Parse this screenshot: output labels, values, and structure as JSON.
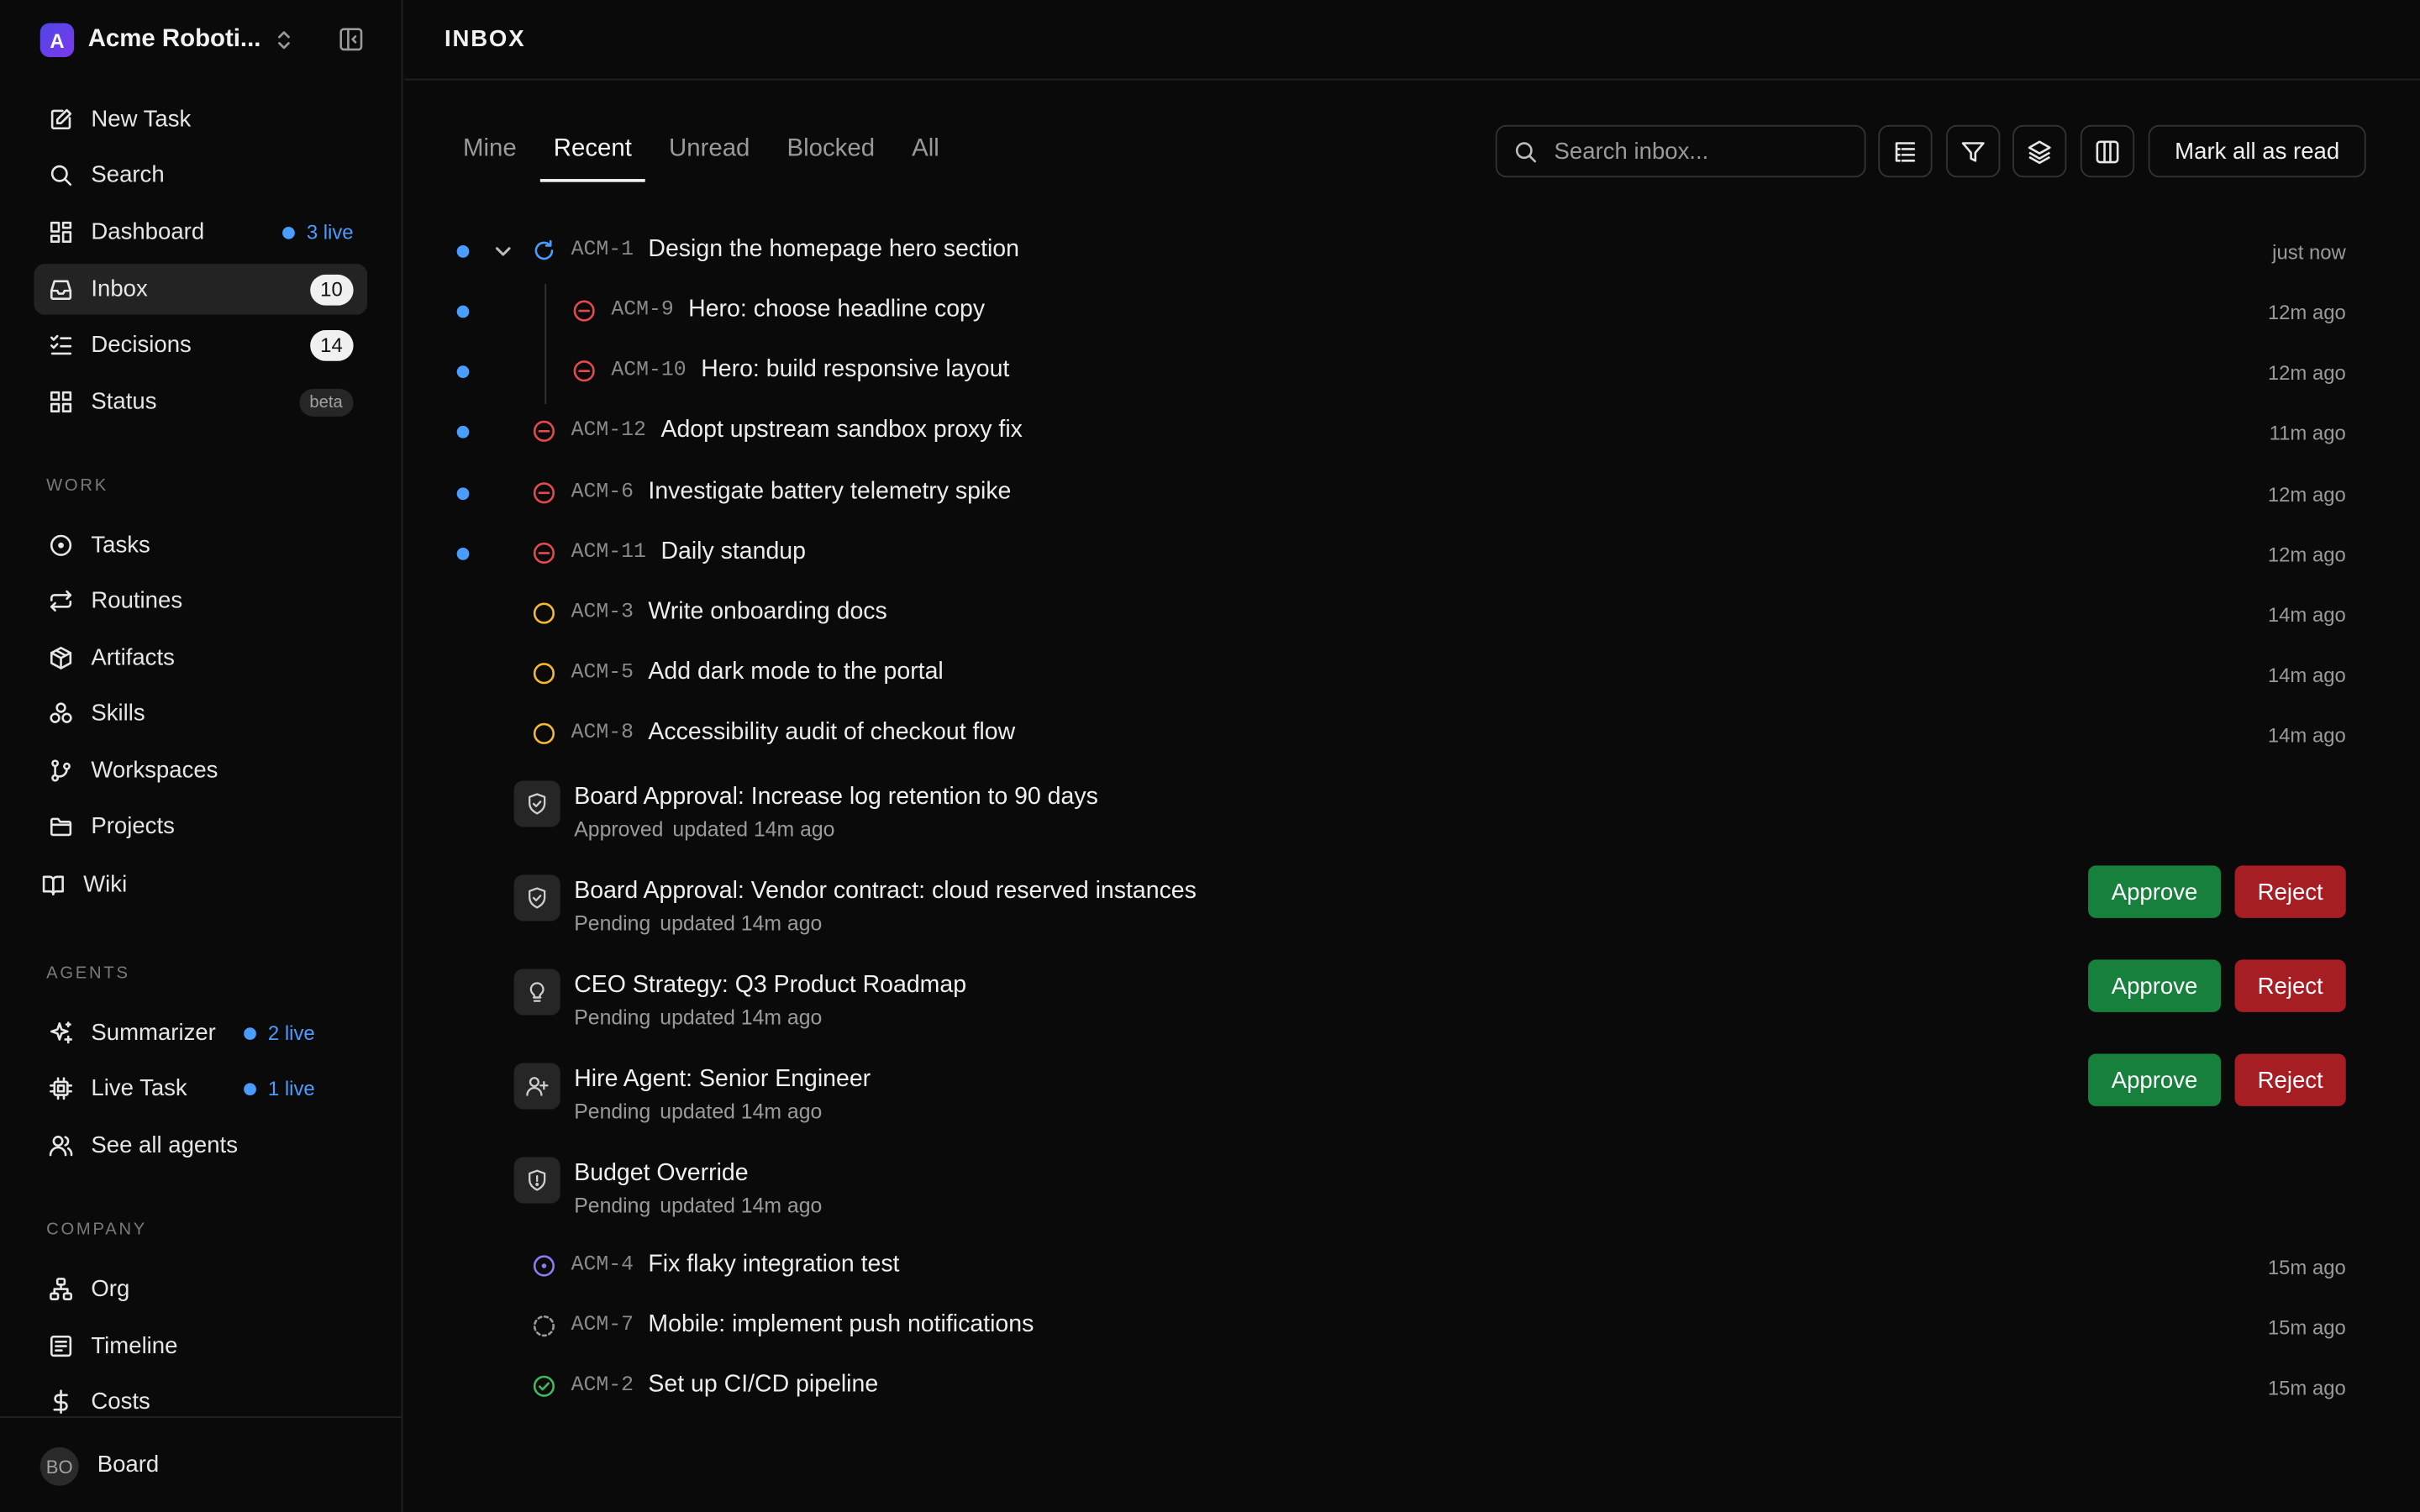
{
  "workspace": {
    "name": "Acme Roboti...",
    "logo_letter": "A"
  },
  "nav": [
    {
      "id": "new-task",
      "label": "New Task",
      "icon": "edit-icon"
    },
    {
      "id": "search",
      "label": "Search",
      "icon": "search-icon"
    },
    {
      "id": "dashboard",
      "label": "Dashboard",
      "icon": "dashboard-icon",
      "live": "3 live"
    },
    {
      "id": "inbox",
      "label": "Inbox",
      "icon": "inbox-icon",
      "count": "10",
      "active": true
    },
    {
      "id": "decisions",
      "label": "Decisions",
      "icon": "checklist-icon",
      "count": "14"
    },
    {
      "id": "status",
      "label": "Status",
      "icon": "grid-icon",
      "badge": "beta"
    }
  ],
  "sections": {
    "work": {
      "label": "WORK",
      "items": [
        {
          "label": "Tasks",
          "icon": "circle-dot-icon"
        },
        {
          "label": "Routines",
          "icon": "repeat-icon"
        },
        {
          "label": "Artifacts",
          "icon": "package-icon"
        },
        {
          "label": "Skills",
          "icon": "boxes-icon"
        },
        {
          "label": "Workspaces",
          "icon": "git-branch-icon"
        },
        {
          "label": "Projects",
          "icon": "folder-icon"
        },
        {
          "label": "Wiki",
          "icon": "book-icon"
        }
      ]
    },
    "agents": {
      "label": "AGENTS",
      "items": [
        {
          "label": "Summarizer",
          "icon": "sparkles-icon",
          "live": "2 live"
        },
        {
          "label": "Live Task",
          "icon": "cpu-icon",
          "live": "1 live"
        },
        {
          "label": "See all agents",
          "icon": "users-icon"
        }
      ]
    },
    "company": {
      "label": "COMPANY",
      "items": [
        {
          "label": "Org",
          "icon": "org-icon"
        },
        {
          "label": "Timeline",
          "icon": "timeline-icon"
        },
        {
          "label": "Costs",
          "icon": "dollar-icon"
        }
      ]
    }
  },
  "user": {
    "initials": "BO",
    "name": "Board"
  },
  "page": {
    "title": "INBOX"
  },
  "tabs": [
    "Mine",
    "Recent",
    "Unread",
    "Blocked",
    "All"
  ],
  "active_tab": "Recent",
  "search": {
    "placeholder": "Search inbox..."
  },
  "mark_all_label": "Mark all as read",
  "tasks_top": [
    {
      "key": "ACM-1",
      "title": "Design the homepage hero section",
      "time": "just now",
      "status": "in-progress",
      "unread": true
    },
    {
      "key": "ACM-9",
      "title": "Hero: choose headline copy",
      "time": "12m ago",
      "status": "blocked",
      "unread": true
    },
    {
      "key": "ACM-10",
      "title": "Hero: build responsive layout",
      "time": "12m ago",
      "status": "blocked",
      "unread": true
    },
    {
      "key": "ACM-12",
      "title": "Adopt upstream sandbox proxy fix",
      "time": "11m ago",
      "status": "blocked",
      "unread": true
    },
    {
      "key": "ACM-6",
      "title": "Investigate battery telemetry spike",
      "time": "12m ago",
      "status": "blocked",
      "unread": true
    },
    {
      "key": "ACM-11",
      "title": "Daily standup",
      "time": "12m ago",
      "status": "blocked",
      "unread": true
    },
    {
      "key": "ACM-3",
      "title": "Write onboarding docs",
      "time": "14m ago",
      "status": "todo",
      "unread": false
    },
    {
      "key": "ACM-5",
      "title": "Add dark mode to the portal",
      "time": "14m ago",
      "status": "todo",
      "unread": false
    },
    {
      "key": "ACM-8",
      "title": "Accessibility audit of checkout flow",
      "time": "14m ago",
      "status": "todo",
      "unread": false
    }
  ],
  "approvals": [
    {
      "title": "Board Approval: Increase log retention to 90 days",
      "state": "Approved",
      "updated": "updated 14m ago",
      "icon": "shield-check-icon",
      "actions": false
    },
    {
      "title": "Board Approval: Vendor contract: cloud reserved instances",
      "state": "Pending",
      "updated": "updated 14m ago",
      "icon": "shield-check-icon",
      "actions": true
    },
    {
      "title": "CEO Strategy: Q3 Product Roadmap",
      "state": "Pending",
      "updated": "updated 14m ago",
      "icon": "lightbulb-icon",
      "actions": true
    },
    {
      "title": "Hire Agent: Senior Engineer",
      "state": "Pending",
      "updated": "updated 14m ago",
      "icon": "user-plus-icon",
      "actions": true
    },
    {
      "title": "Budget Override",
      "state": "Pending",
      "updated": "updated 14m ago",
      "icon": "shield-alert-icon",
      "actions": false
    }
  ],
  "approve_label": "Approve",
  "reject_label": "Reject",
  "tasks_bottom": [
    {
      "key": "ACM-4",
      "title": "Fix flaky integration test",
      "time": "15m ago",
      "status": "in-review"
    },
    {
      "key": "ACM-7",
      "title": "Mobile: implement push notifications",
      "time": "15m ago",
      "status": "backlog"
    },
    {
      "key": "ACM-2",
      "title": "Set up CI/CD pipeline",
      "time": "15m ago",
      "status": "done"
    }
  ],
  "colors": {
    "accent_blue": "#4b9cff",
    "blocked_red": "#e5484d",
    "todo_yellow": "#f5b833",
    "review_purple": "#8b7cf6",
    "done_green": "#3fb95f",
    "approve_green": "#16803c",
    "reject_red": "#a61d24"
  }
}
